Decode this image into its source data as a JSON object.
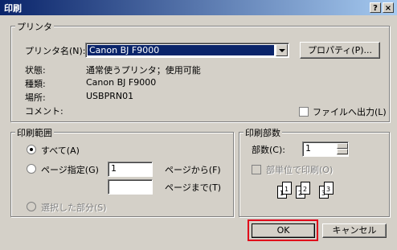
{
  "window": {
    "title": "印刷",
    "help_btn": "?",
    "close_btn": "×"
  },
  "printer_group": {
    "label": "プリンタ",
    "name_label": "プリンタ名(N):",
    "name_value": "Canon BJ F9000",
    "properties_button": "プロパティ(P)...",
    "status_label": "状態:",
    "status_value": "通常使うプリンタ；使用可能",
    "type_label": "種類:",
    "type_value": "Canon BJ F9000",
    "where_label": "場所:",
    "where_value": "USBPRN01",
    "comment_label": "コメント:",
    "print_to_file_label": "ファイルへ出力(L)"
  },
  "range_group": {
    "label": "印刷範囲",
    "all_label": "すべて(A)",
    "pages_label": "ページ指定(G)",
    "from_value": "1",
    "to_value": "",
    "from_label": "ページから(F)",
    "to_label": "ページまで(T)",
    "selection_label": "選択した部分(S)"
  },
  "copies_group": {
    "label": "印刷部数",
    "copies_label": "部数(C):",
    "copies_value": "1",
    "collate_label": "部単位で印刷(O)",
    "pages": [
      "1",
      "1",
      "2",
      "2",
      "3",
      "3"
    ]
  },
  "buttons": {
    "ok": "OK",
    "cancel": "キャンセル"
  },
  "colors": {
    "titlebar_start": "#0a246a",
    "titlebar_end": "#a6caf0",
    "highlight_box": "#e0001a"
  }
}
